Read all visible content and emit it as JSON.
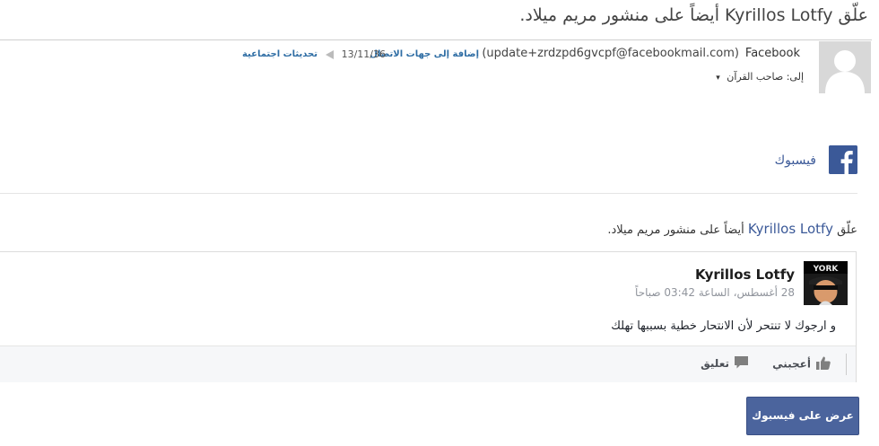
{
  "email": {
    "subject": "علّق Kyrillos Lotfy أيضاً على منشور مريم ميلاد.",
    "from_name": "Facebook",
    "from_address": "(update+zrdzpd6gvcpf@facebookmail.com)",
    "add_to_contacts": "إضافة إلى جهات الاتصال",
    "date": "13/11/36",
    "social_updates": "تحديثات اجتماعية",
    "to_label": "إلى: صاحب القرآن"
  },
  "body": {
    "brand_label": "فيسبوك",
    "notification_name": "Kyrillos Lotfy",
    "notification_prefix": "علّق",
    "notification_suffix": "أيضاً على منشور مريم ميلاد."
  },
  "post": {
    "author": "Kyrillos Lotfy",
    "avatar_text": "YORK",
    "timestamp": "28 أغسطس، الساعة 03:42 صباحاً",
    "text": "و ارجوك لا تنتحر لأن الانتحار خطية بسببها تهلك",
    "like_label": "أعجبني",
    "comment_label": "تعليق"
  },
  "cta": {
    "view_on_facebook": "عرض على فيسبوك"
  },
  "colors": {
    "facebook_blue": "#3b5998",
    "button_blue": "#4b649d",
    "link_blue": "#2e6da4"
  },
  "icons": [
    "default-avatar-icon",
    "flag-icon",
    "chevron-down-icon",
    "facebook-logo-icon",
    "like-icon",
    "comment-icon"
  ]
}
